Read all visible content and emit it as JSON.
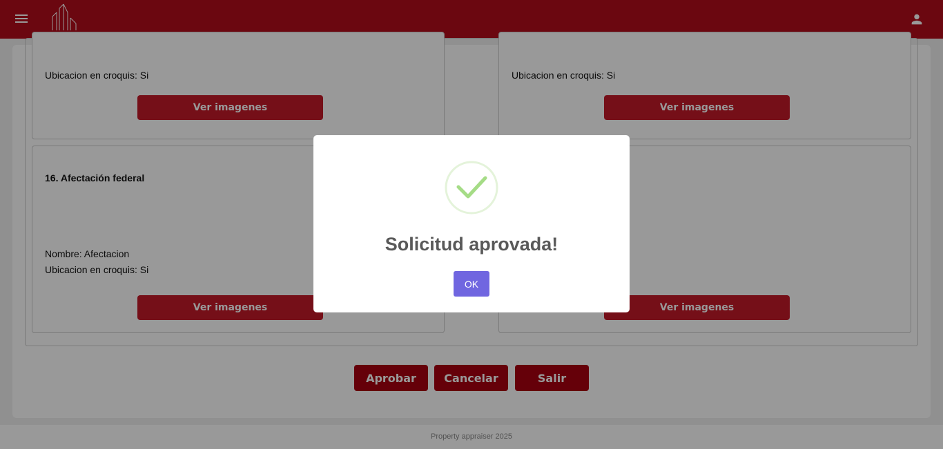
{
  "header": {
    "logo_text": "PROPERTY APPRAISER",
    "menu_icon": "menu-icon",
    "user_icon": "user-icon"
  },
  "cards": {
    "top_left": {
      "ubicacion": "Ubicacion en croquis: Si",
      "button": "Ver imagenes"
    },
    "top_right": {
      "ubicacion": "Ubicacion en croquis: Si",
      "button": "Ver imagenes"
    },
    "bottom_left": {
      "title": "16. Afectación federal",
      "nombre": "Nombre: Afectacion",
      "ubicacion": "Ubicacion en croquis: Si",
      "button": "Ver imagenes"
    },
    "bottom_right": {
      "button": "Ver imagenes"
    }
  },
  "actions": {
    "approve": "Aprobar",
    "cancel": "Cancelar",
    "exit": "Salir"
  },
  "footer": {
    "text": "Property appraiser 2025"
  },
  "modal": {
    "title": "Solicitud aprovada!",
    "ok": "OK",
    "icon": "success-check-icon"
  },
  "colors": {
    "brand": "#b30c1b",
    "button": "#c41929",
    "modal_ok": "#7066e0",
    "success": "#a5dc86"
  }
}
